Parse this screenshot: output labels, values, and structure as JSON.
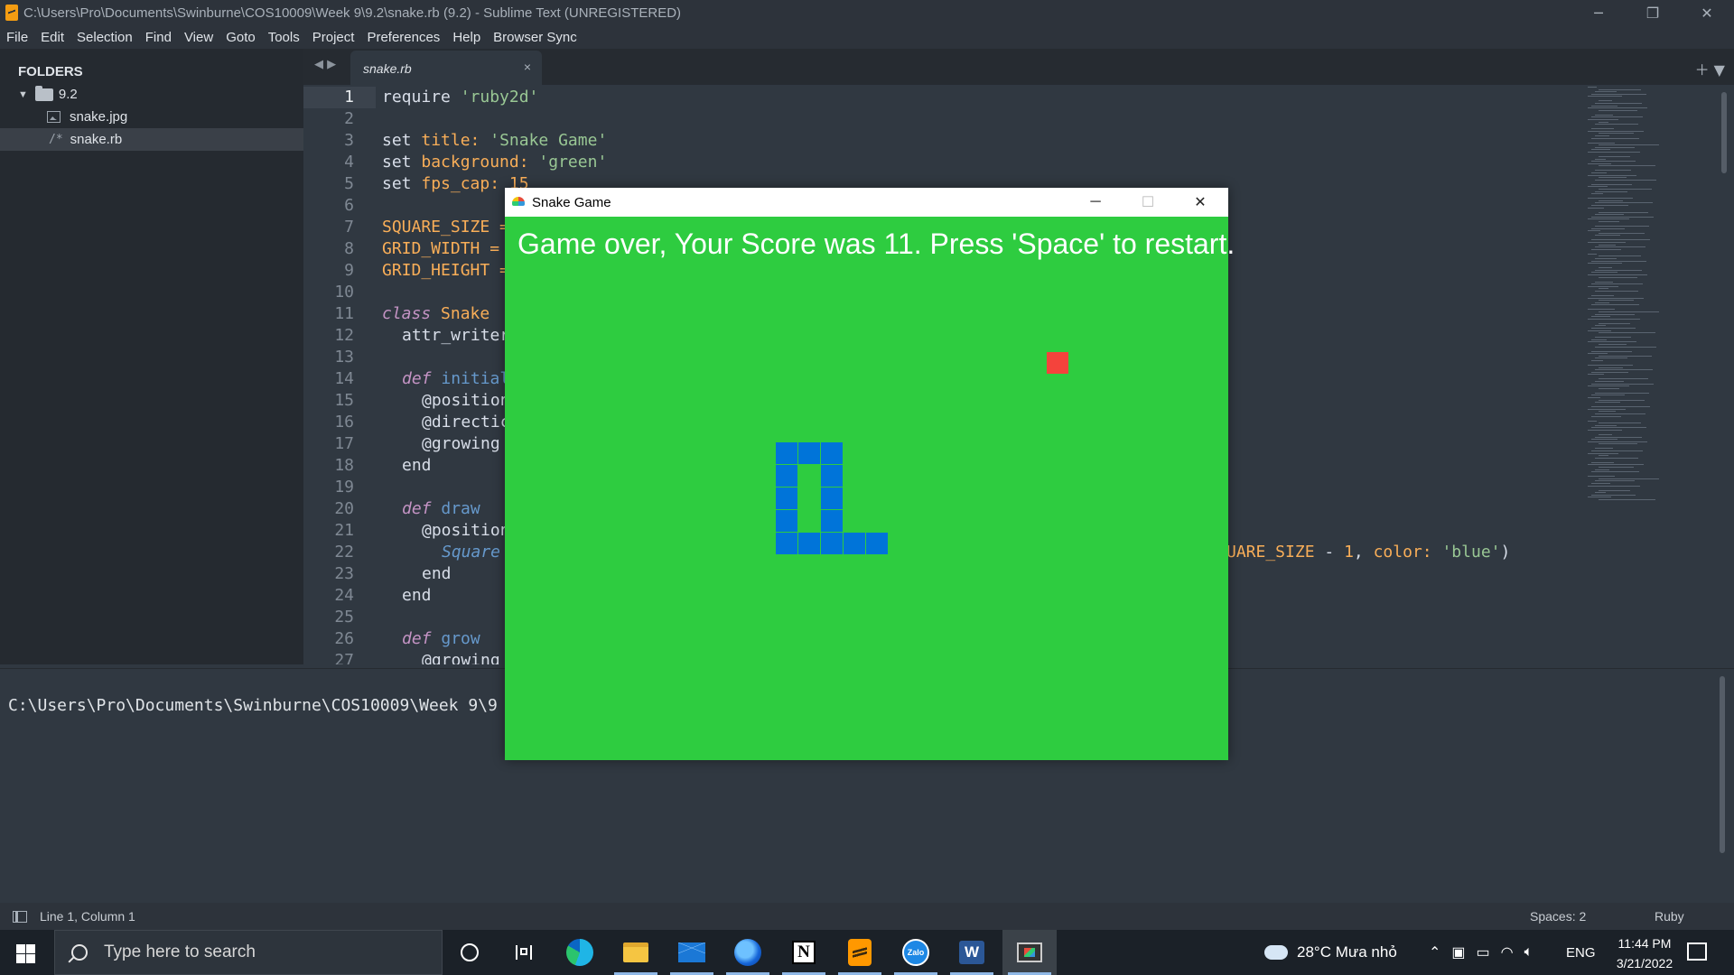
{
  "window": {
    "title": "C:\\Users\\Pro\\Documents\\Swinburne\\COS10009\\Week 9\\9.2\\snake.rb (9.2) - Sublime Text (UNREGISTERED)",
    "minimize_glyph": "─",
    "restore_glyph": "❐",
    "close_glyph": "✕"
  },
  "menu": [
    "File",
    "Edit",
    "Selection",
    "Find",
    "View",
    "Goto",
    "Tools",
    "Project",
    "Preferences",
    "Help",
    "Browser Sync"
  ],
  "sidebar": {
    "header": "FOLDERS",
    "folder": "9.2",
    "files": [
      "snake.jpg",
      "snake.rb"
    ],
    "selected_file": "snake.rb"
  },
  "tabs": [
    {
      "label": "snake.rb",
      "close": "×"
    }
  ],
  "editor": {
    "line_numbers": [
      "1",
      "2",
      "3",
      "4",
      "5",
      "6",
      "7",
      "8",
      "9",
      "10",
      "11",
      "12",
      "13",
      "14",
      "15",
      "16",
      "17",
      "18",
      "19",
      "20",
      "21",
      "22",
      "23",
      "24",
      "25",
      "26",
      "27"
    ],
    "visible_code": {
      "l1": [
        "require ",
        "'ruby2d'"
      ],
      "l3": [
        "set ",
        "title:",
        " ",
        "'Snake Game'"
      ],
      "l4": [
        "set ",
        "background:",
        " ",
        "'green'"
      ],
      "l5": [
        "set ",
        "fps_cap:",
        " ",
        "15"
      ],
      "l7": "SQUARE_SIZE =",
      "l8": "GRID_WIDTH =",
      "l9": "GRID_HEIGHT =",
      "l11": [
        "class",
        " ",
        "Snake"
      ],
      "l12": "attr_writer",
      "l14": [
        "def",
        " ",
        "initial"
      ],
      "l15": "@position",
      "l16": "@directic",
      "l17": "@growing ",
      "l18": "end",
      "l20": [
        "def",
        " ",
        "draw"
      ],
      "l21": "@position",
      "l22_left": "Square",
      "l22_right": [
        "UARE_SIZE ",
        "-",
        " ",
        "1",
        ", ",
        "color:",
        " ",
        "'blue'",
        ")"
      ],
      "l23": "end",
      "l24": "end",
      "l26": [
        "def",
        " ",
        "grow"
      ],
      "l27": "@growing"
    }
  },
  "console": {
    "text": "C:\\Users\\Pro\\Documents\\Swinburne\\COS10009\\Week 9\\9"
  },
  "status": {
    "position": "Line 1, Column 1",
    "spaces": "Spaces: 2",
    "syntax": "Ruby"
  },
  "game_window": {
    "title": "Snake Game",
    "message": "Game over, Your Score was 11. Press 'Space' to restart.",
    "background_color": "#2ecc40",
    "snake_color": "#0074d9",
    "food_color": "#f4433c",
    "food_cell": [
      24,
      6
    ],
    "snake_cells": [
      [
        12,
        10
      ],
      [
        13,
        10
      ],
      [
        14,
        10
      ],
      [
        12,
        11
      ],
      [
        14,
        11
      ],
      [
        12,
        12
      ],
      [
        14,
        12
      ],
      [
        12,
        13
      ],
      [
        14,
        13
      ],
      [
        12,
        14
      ],
      [
        13,
        14
      ],
      [
        14,
        14
      ],
      [
        15,
        14
      ],
      [
        16,
        14
      ]
    ]
  },
  "taskbar": {
    "search_placeholder": "Type here to search",
    "apps": [
      "cortana-icon",
      "task-view-icon",
      "edge-icon",
      "file-explorer-icon",
      "mail-icon",
      "firefox-icon",
      "notion-icon",
      "sublime-icon",
      "zalo-icon",
      "word-icon",
      "ruby-window-icon"
    ],
    "zalo_label": "Zalo",
    "notion_label": "N",
    "word_label": "W",
    "weather": "28°C  Mưa nhỏ",
    "language": "ENG",
    "time": "11:44 PM",
    "date": "3/21/2022"
  }
}
